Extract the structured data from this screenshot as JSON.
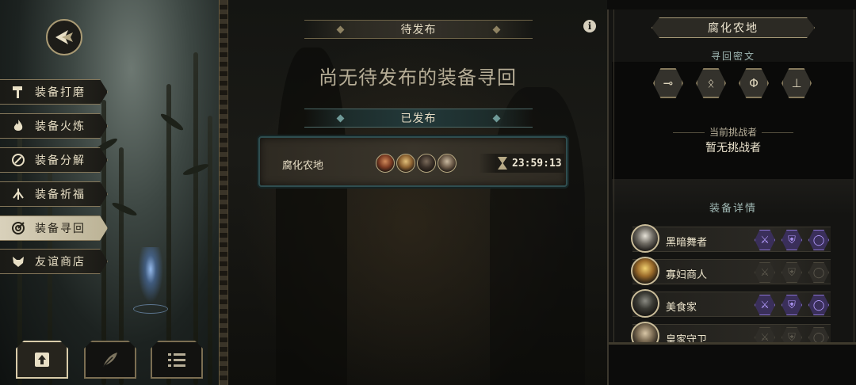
{
  "side_menu": {
    "items": [
      {
        "label": "装备打磨",
        "icon": "hammer-icon"
      },
      {
        "label": "装备火炼",
        "icon": "flame-icon"
      },
      {
        "label": "装备分解",
        "icon": "disassemble-icon"
      },
      {
        "label": "装备祈福",
        "icon": "blessing-icon"
      },
      {
        "label": "装备寻回",
        "icon": "retrieve-icon",
        "active": true
      },
      {
        "label": "友谊商店",
        "icon": "fox-shop-icon"
      }
    ]
  },
  "bottom_buttons": [
    {
      "icon": "publish-upload-icon",
      "active": true
    },
    {
      "icon": "feather-icon"
    },
    {
      "icon": "list-icon"
    }
  ],
  "center": {
    "pending_title": "待发布",
    "empty_message": "尚无待发布的装备寻回",
    "published_title": "已发布",
    "quest": {
      "location": "腐化农地",
      "timer": "23:59:13",
      "hero_portraits": 4
    }
  },
  "right_panel": {
    "title": "腐化农地",
    "runes_label": "寻回密文",
    "runes": [
      "⊸",
      "ᛟ",
      "Φ",
      "⊥"
    ],
    "challenger_label": "当前挑战者",
    "challenger_value": "暂无挑战者",
    "equip_label": "装备详情",
    "heroes": [
      {
        "name": "黑暗舞者",
        "slots": [
          true,
          true,
          true
        ]
      },
      {
        "name": "寡妇商人",
        "slots": [
          false,
          false,
          false
        ]
      },
      {
        "name": "美食家",
        "slots": [
          true,
          true,
          true
        ]
      },
      {
        "name": "皇家守卫",
        "slots": [
          false,
          false,
          false
        ]
      }
    ]
  },
  "colors": {
    "accent_gold": "#a99a74",
    "teal": "#4d6a68",
    "purple_slot": "#8b74d4"
  }
}
